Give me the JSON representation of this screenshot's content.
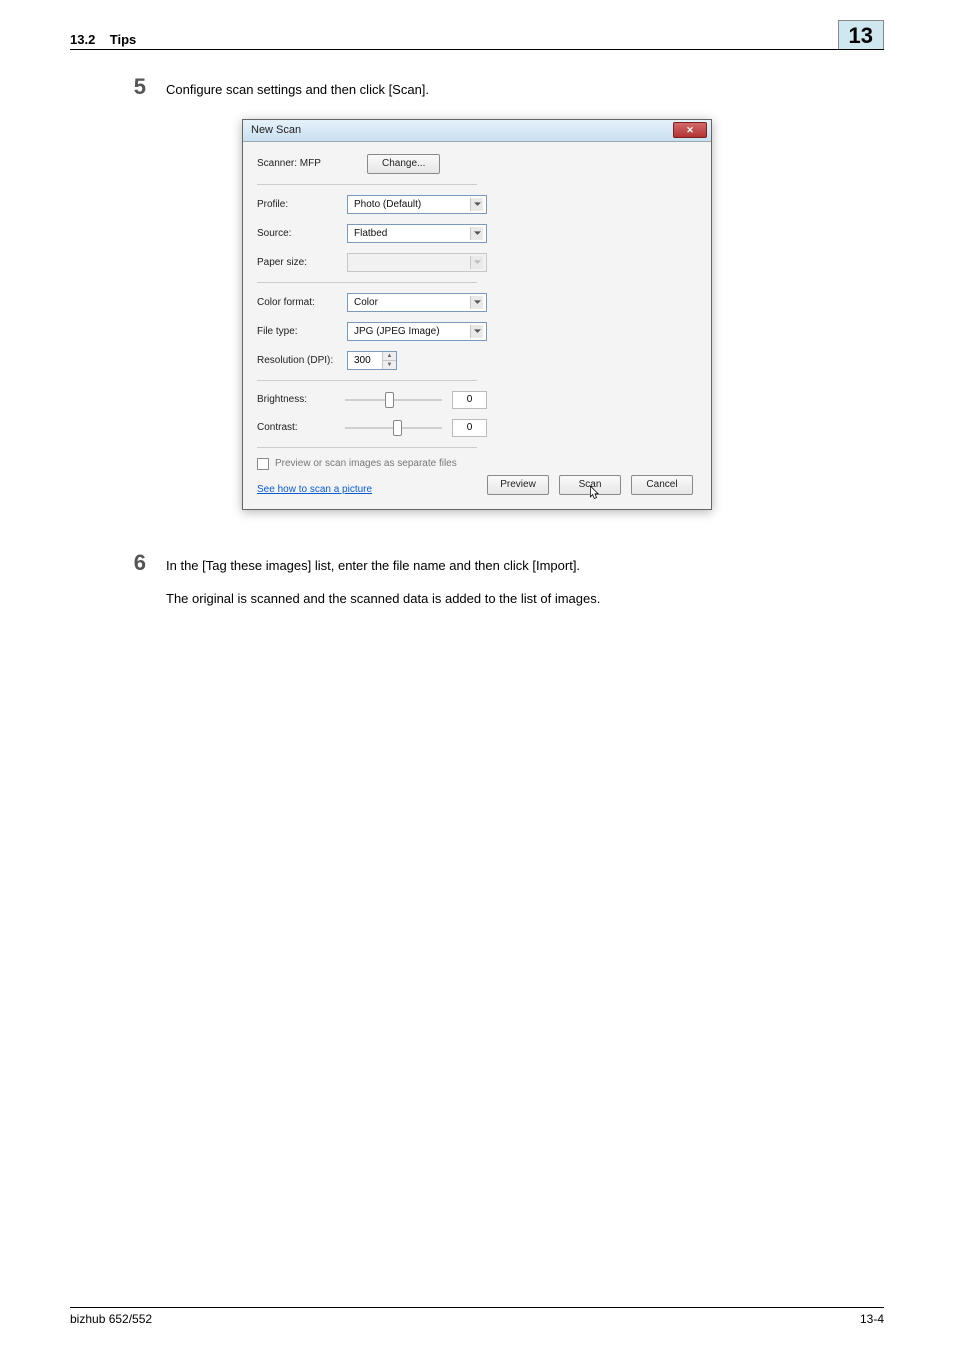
{
  "header": {
    "section_num": "13.2",
    "section_title": "Tips",
    "chapter_num": "13"
  },
  "steps": {
    "s5": {
      "num": "5",
      "text": "Configure scan settings and then click [Scan]."
    },
    "s6": {
      "num": "6",
      "line1": "In the [Tag these images] list, enter the file name and then click [Import].",
      "line2": "The original is scanned and the scanned data is added to the list of images."
    }
  },
  "dialog": {
    "title": "New Scan",
    "close_glyph": "✕",
    "scanner_label": "Scanner: MFP",
    "change_btn": "Change...",
    "profile_label": "Profile:",
    "profile_value": "Photo (Default)",
    "source_label": "Source:",
    "source_value": "Flatbed",
    "papersize_label": "Paper size:",
    "papersize_value": "",
    "colorformat_label": "Color format:",
    "colorformat_value": "Color",
    "filetype_label": "File type:",
    "filetype_value": "JPG (JPEG Image)",
    "resolution_label": "Resolution (DPI):",
    "resolution_value": "300",
    "brightness_label": "Brightness:",
    "brightness_value": "0",
    "contrast_label": "Contrast:",
    "contrast_value": "0",
    "separate_files_label": "Preview or scan images as separate files",
    "help_link": "See how to scan a picture",
    "preview_btn": "Preview",
    "scan_btn": "Scan",
    "cancel_btn": "Cancel"
  },
  "footer": {
    "left": "bizhub 652/552",
    "right": "13-4"
  }
}
